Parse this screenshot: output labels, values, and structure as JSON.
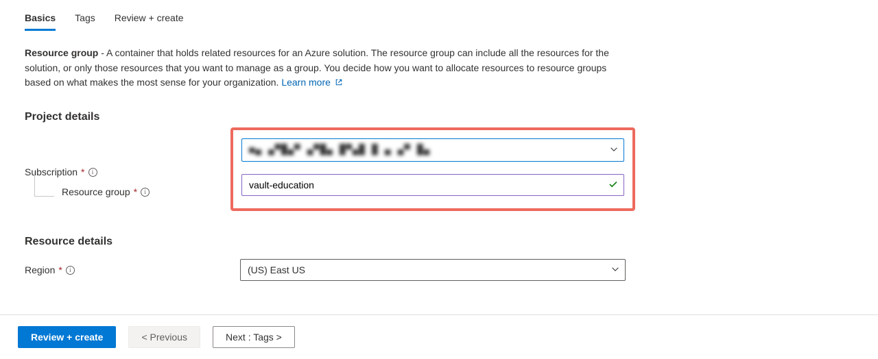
{
  "tabs": {
    "basics": "Basics",
    "tags": "Tags",
    "review": "Review + create"
  },
  "description": {
    "bold_lead": "Resource group",
    "body": " - A container that holds related resources for an Azure solution. The resource group can include all the resources for the solution, or only those resources that you want to manage as a group. You decide how you want to allocate resources to resource groups based on what makes the most sense for your organization. ",
    "learn_more": "Learn more"
  },
  "sections": {
    "project": "Project details",
    "resource": "Resource details"
  },
  "fields": {
    "subscription_label": "Subscription",
    "subscription_value": "■▄ ▄▀█▄▀ ▄▀█▄ █▀▄█ █ ▄ ▄▀ █▄",
    "resource_group_label": "Resource group",
    "resource_group_value": "vault-education",
    "region_label": "Region",
    "region_value": "(US) East US"
  },
  "buttons": {
    "review_create": "Review + create",
    "previous": "< Previous",
    "next": "Next : Tags >"
  }
}
